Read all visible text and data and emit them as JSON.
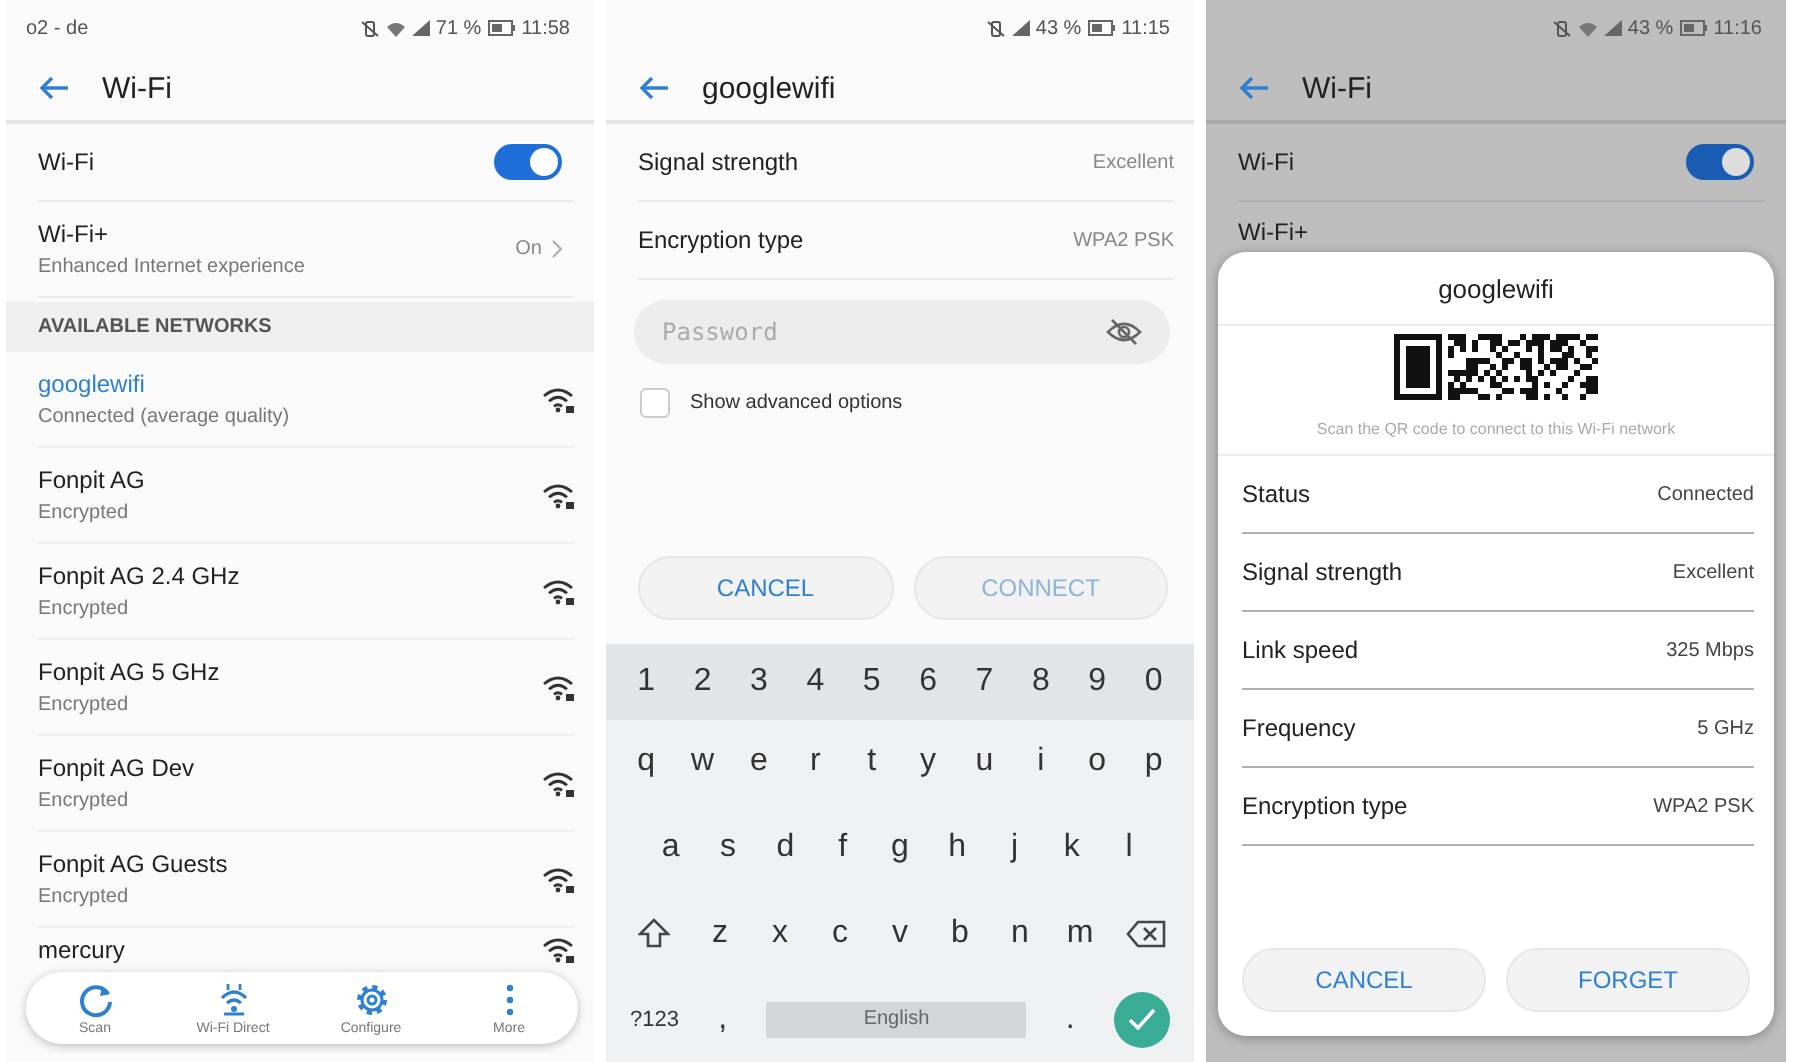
{
  "wifi_screen": {
    "status_bar": {
      "carrier": "o2 - de",
      "icons": [
        {
          "kind": "vibrate_off"
        },
        {
          "kind": "wifi"
        },
        {
          "kind": "signal"
        }
      ],
      "battery": "71 %",
      "time": "11:58"
    },
    "title": "Wi-Fi",
    "wifi_toggle": {
      "label": "Wi-Fi",
      "on": true
    },
    "wifi_plus": {
      "label": "Wi-Fi+",
      "subtitle": "Enhanced Internet experience",
      "value": "On"
    },
    "section": "AVAILABLE NETWORKS",
    "networks": [
      {
        "name": "googlewifi",
        "status": "Connected (average quality)",
        "connected": true
      },
      {
        "name": "Fonpit AG",
        "status": "Encrypted",
        "connected": false
      },
      {
        "name": "Fonpit AG 2.4 GHz",
        "status": "Encrypted",
        "connected": false
      },
      {
        "name": "Fonpit AG 5 GHz",
        "status": "Encrypted",
        "connected": false
      },
      {
        "name": "Fonpit AG Dev",
        "status": "Encrypted",
        "connected": false
      },
      {
        "name": "Fonpit AG Guests",
        "status": "Encrypted",
        "connected": false
      },
      {
        "name": "mercury",
        "connected": false
      }
    ],
    "toolbar": [
      {
        "label": "Scan"
      },
      {
        "label": "Wi-Fi Direct"
      },
      {
        "label": "Configure"
      },
      {
        "label": "More"
      }
    ]
  },
  "connect_screen": {
    "status_bar": {
      "icons": [
        {
          "kind": "vibrate_off"
        },
        {
          "kind": "signal"
        }
      ],
      "battery": "43 %",
      "time": "11:15"
    },
    "title": "googlewifi",
    "rows": [
      {
        "label": "Signal strength",
        "value": "Excellent"
      },
      {
        "label": "Encryption type",
        "value": "WPA2 PSK"
      }
    ],
    "password": {
      "placeholder": "Password"
    },
    "advanced": {
      "label": "Show advanced options",
      "checked": false
    },
    "buttons": [
      {
        "label": "CANCEL",
        "disabled": false
      },
      {
        "label": "CONNECT",
        "disabled": true
      }
    ],
    "keyboard": {
      "number_row": [
        "1",
        "2",
        "3",
        "4",
        "5",
        "6",
        "7",
        "8",
        "9",
        "0"
      ],
      "letter_rows": [
        [
          "q",
          "w",
          "e",
          "r",
          "t",
          "y",
          "u",
          "i",
          "o",
          "p"
        ],
        [
          "a",
          "s",
          "d",
          "f",
          "g",
          "h",
          "j",
          "k",
          "l"
        ],
        [
          "z",
          "x",
          "c",
          "v",
          "b",
          "n",
          "m"
        ]
      ],
      "symbols_key": "?123",
      "comma": ",",
      "space": "English",
      "period": "."
    }
  },
  "details_screen": {
    "status_bar": {
      "icons": [
        {
          "kind": "vibrate_off"
        },
        {
          "kind": "wifi"
        },
        {
          "kind": "signal"
        }
      ],
      "battery": "43 %",
      "time": "11:16"
    },
    "title": "Wi-Fi",
    "wifi_toggle": {
      "label": "Wi-Fi",
      "on": true
    },
    "wifi_plus_label": "Wi-Fi+",
    "dialog": {
      "title": "googlewifi",
      "caption": "Scan the QR code to connect to this Wi-Fi network",
      "rows": [
        {
          "label": "Status",
          "value": "Connected"
        },
        {
          "label": "Signal strength",
          "value": "Excellent"
        },
        {
          "label": "Link speed",
          "value": "325 Mbps"
        },
        {
          "label": "Frequency",
          "value": "5 GHz"
        },
        {
          "label": "Encryption type",
          "value": "WPA2 PSK"
        }
      ],
      "buttons": [
        {
          "label": "CANCEL"
        },
        {
          "label": "FORGET"
        }
      ]
    }
  }
}
